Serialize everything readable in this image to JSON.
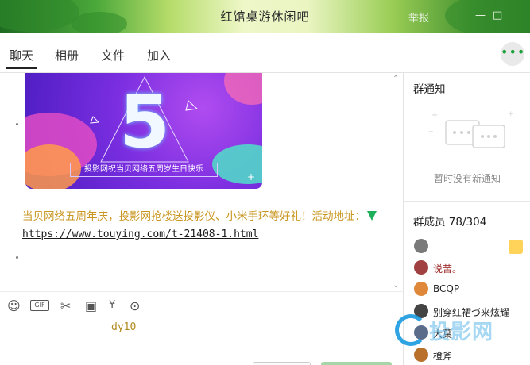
{
  "window": {
    "title": "红馆桌游休闲吧",
    "report_label": "举报",
    "minimize_glyph": "—",
    "close_glyph": "□"
  },
  "tabs": [
    {
      "label": "聊天",
      "active": true
    },
    {
      "label": "相册",
      "active": false
    },
    {
      "label": "文件",
      "active": false
    },
    {
      "label": "加入",
      "active": false
    }
  ],
  "more_button_glyph": "•••",
  "chat": {
    "promo_image": {
      "big_number": "5",
      "caption": "投影网祝当贝网络五周岁生日快乐"
    },
    "message_text": "当贝网络五周年庆，投影网抢楼送投影仪、小米手环等好礼！活动地址：",
    "message_link": "https://www.touying.com/t-21408-1.html"
  },
  "toolbar": {
    "emoji_icon": "☺",
    "gif_label": "GIF",
    "scissors_icon": "✂",
    "image_icon": "▣",
    "currency_icon": "¥",
    "more_icon": "⊙"
  },
  "input": {
    "value": "dy10"
  },
  "notice": {
    "title": "群通知",
    "empty_text": "暂时没有新通知"
  },
  "members": {
    "title": "群成员 78/304",
    "list": [
      {
        "name": "",
        "color": "#7a7a7a"
      },
      {
        "name": "说苦。",
        "color": "#a04040"
      },
      {
        "name": "BCQP",
        "color": "#e0883a"
      },
      {
        "name": "别穿红裙づ来炫耀",
        "color": "#444444"
      },
      {
        "name": "大葉",
        "color": "#5a6c8a"
      },
      {
        "name": "橙斧",
        "color": "#b8702a"
      }
    ]
  },
  "watermark": {
    "text": "投影网"
  },
  "colors": {
    "accent_green": "#1da23b",
    "link_text": "#c8961e",
    "promo_purple": "#7a2ee0"
  }
}
